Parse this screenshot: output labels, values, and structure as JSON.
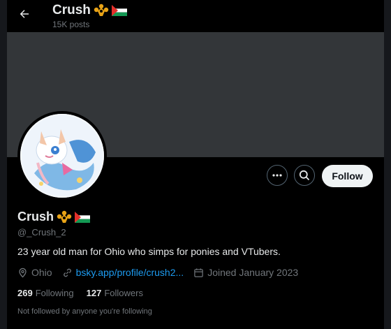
{
  "header": {
    "title": "Crush",
    "posts_count": "15K posts"
  },
  "profile": {
    "display_name": "Crush",
    "handle": "@_Crush_2",
    "bio": "23 year old man for Ohio who simps for ponies and VTubers.",
    "location": "Ohio",
    "link": "bsky.app/profile/crush2...",
    "joined": "Joined January 2023"
  },
  "stats": {
    "following_count": "269",
    "following_label": "Following",
    "followers_count": "127",
    "followers_label": "Followers"
  },
  "actions": {
    "follow_label": "Follow"
  },
  "notice": "Not followed by anyone you're following",
  "icons": {
    "back": "arrow-left-icon",
    "more": "more-icon",
    "search": "search-icon",
    "location": "location-pin-icon",
    "link": "link-icon",
    "calendar": "calendar-icon",
    "badge": "crown-badge-icon",
    "flag": "palestine-flag-icon"
  },
  "colors": {
    "background": "#000000",
    "banner": "#333639",
    "text_primary": "#e7e9ea",
    "text_secondary": "#71767b",
    "link": "#1d9bf0",
    "follow_button": "#eff3f4",
    "badge_gold": "#e8a317"
  }
}
